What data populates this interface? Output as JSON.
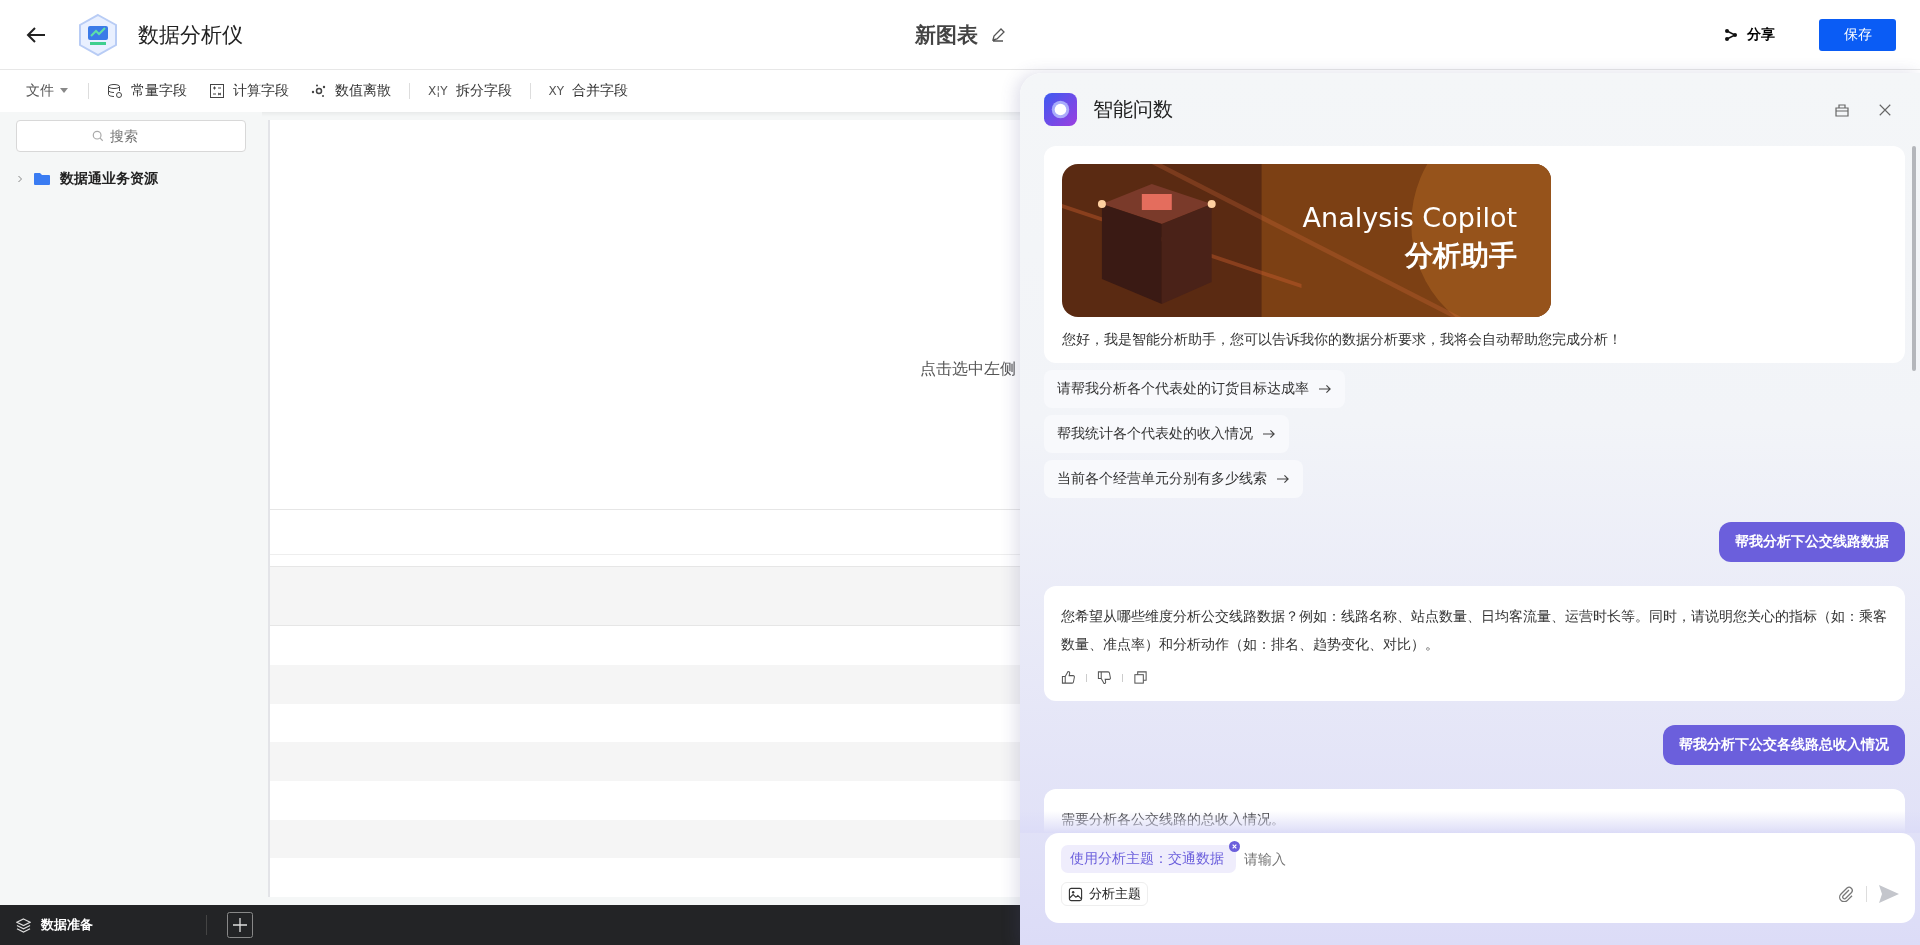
{
  "header": {
    "title": "数据分析仪",
    "chart_name": "新图表",
    "share": "分享",
    "save": "保存"
  },
  "toolbar": {
    "file_menu": "文件",
    "items": [
      {
        "kind": "database",
        "label": "常量字段"
      },
      {
        "kind": "calculator",
        "label": "计算字段"
      },
      {
        "kind": "scatter",
        "label": "数值离散"
      },
      {
        "kind": "glyph",
        "glyph": "X¦Y",
        "label": "拆分字段"
      },
      {
        "kind": "glyph",
        "glyph": "XY",
        "label": "合并字段"
      }
    ]
  },
  "sidebar": {
    "search_placeholder": "搜索",
    "tree": [
      {
        "label": "数据通业务资源",
        "expanded": false
      }
    ]
  },
  "canvas": {
    "hint": "点击选中左侧"
  },
  "bottom_bar": {
    "tab": "数据准备"
  },
  "assistant": {
    "title": "智能问数",
    "banner": {
      "title": "Analysis Copilot",
      "subtitle": "分析助手"
    },
    "greeting": "您好，我是智能分析助手，您可以告诉我你的数据分析要求，我将会自动帮助您完成分析！",
    "suggestions": [
      "请帮我分析各个代表处的订货目标达成率",
      "帮我统计各个代表处的收入情况",
      "当前各个经营单元分别有多少线索"
    ],
    "messages": [
      {
        "kind": "user",
        "text": "帮我分析下公交线路数据"
      },
      {
        "kind": "assistant",
        "text": "您希望从哪些维度分析公交线路数据？例如：线路名称、站点数量、日均客流量、运营时长等。同时，请说明您关心的指标（如：乘客数量、准点率）和分析动作（如：排名、趋势变化、对比）。",
        "actions": true
      },
      {
        "kind": "user",
        "text": "帮我分析下公交各线路总收入情况"
      },
      {
        "kind": "assistant",
        "text": "需要分析各公交线路的总收入情况。",
        "actions": false
      }
    ],
    "input": {
      "topic_tag": "使用分析主题：交通数据",
      "placeholder": "请输入",
      "topic_button": "分析主题"
    }
  }
}
